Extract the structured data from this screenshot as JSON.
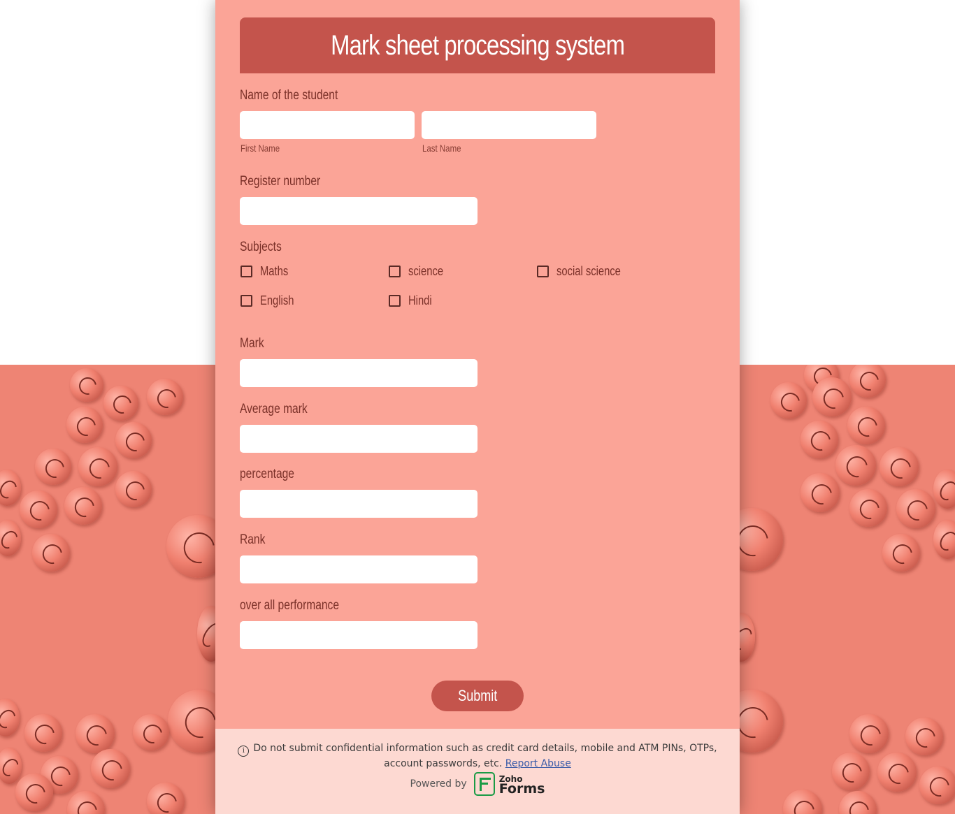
{
  "form": {
    "title": "Mark sheet processing system",
    "name_label": "Name of the student",
    "first_name_sub": "First Name",
    "last_name_sub": "Last Name",
    "register_label": "Register number",
    "subjects_label": "Subjects",
    "subjects": [
      "Maths",
      "science",
      "social science",
      "English",
      "Hindi"
    ],
    "mark_label": "Mark",
    "average_label": "Average mark",
    "percentage_label": "percentage",
    "rank_label": "Rank",
    "performance_label": "over all performance",
    "submit_label": "Submit"
  },
  "footer": {
    "notice": "Do not submit confidential information such as credit card details, mobile and ATM PINs, OTPs, account passwords, etc.",
    "report_link": "Report Abuse",
    "powered_by": "Powered by",
    "brand_top": "Zoho",
    "brand_bottom": "Forms"
  },
  "colors": {
    "card_bg": "#fba497",
    "header_bg": "#c4544c",
    "page_pattern": "#ee8474",
    "footer_bg": "#fdd9d2",
    "brand_green": "#1a9b45"
  }
}
